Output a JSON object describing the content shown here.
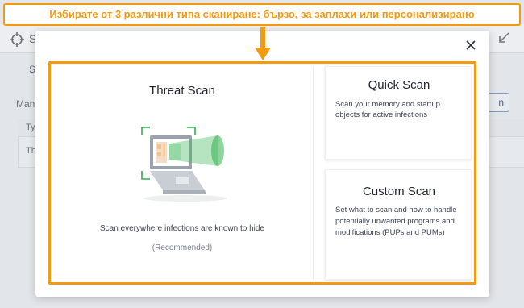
{
  "annotation": {
    "banner_text": "Избирате от 3 различни типа сканиране: бързо, за заплахи или персонализирано"
  },
  "background": {
    "title": "S",
    "tab": "S",
    "manage_label": "Mana",
    "button_label": "n",
    "table_header": "Ty",
    "table_cell": "Thr"
  },
  "modal": {
    "close_icon": "close-icon",
    "threat_scan": {
      "title": "Threat Scan",
      "description": "Scan everywhere infections are known to hide",
      "recommended": "(Recommended)"
    },
    "quick_scan": {
      "title": "Quick Scan",
      "description": "Scan your memory and startup objects for active infections"
    },
    "custom_scan": {
      "title": "Custom Scan",
      "description": "Set what to scan and how to handle potentially unwanted programs and modifications (PUPs and PUMs)"
    }
  },
  "colors": {
    "annotation_orange": "#f29a11",
    "scan_green": "#2fb34a"
  }
}
